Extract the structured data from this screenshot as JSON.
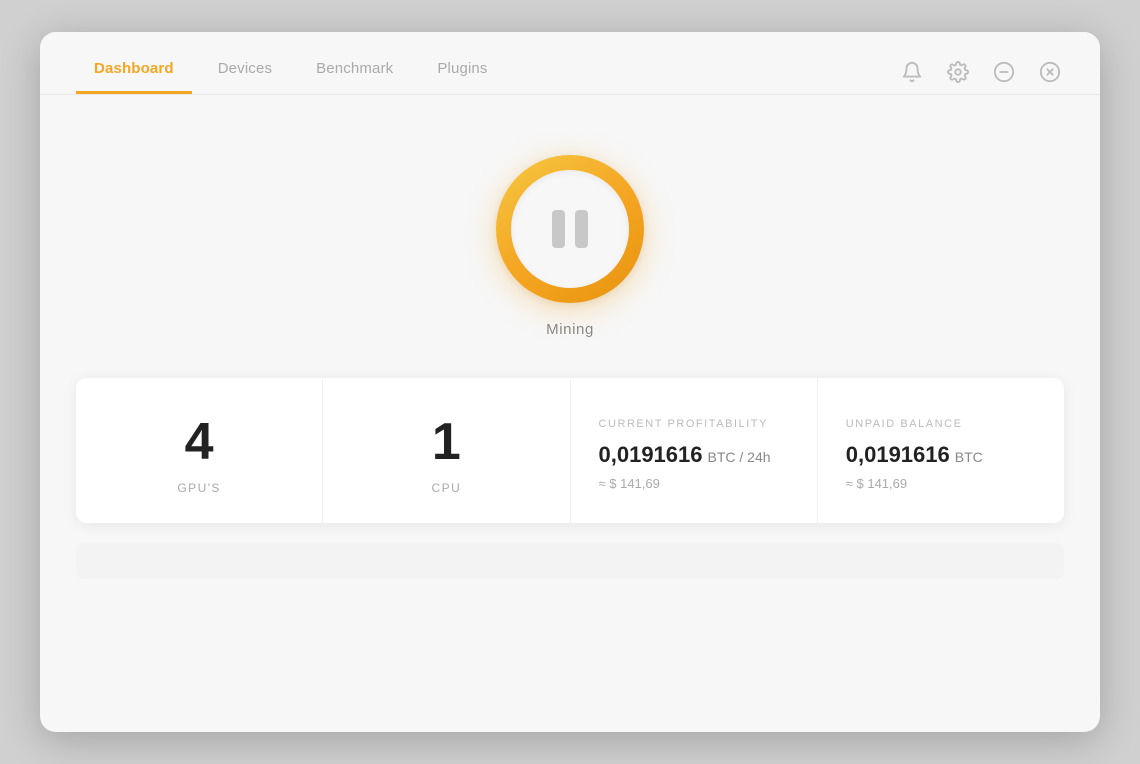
{
  "nav": {
    "tabs": [
      {
        "id": "dashboard",
        "label": "Dashboard",
        "active": true
      },
      {
        "id": "devices",
        "label": "Devices",
        "active": false
      },
      {
        "id": "benchmark",
        "label": "Benchmark",
        "active": false
      },
      {
        "id": "plugins",
        "label": "Plugins",
        "active": false
      }
    ]
  },
  "header_icons": {
    "bell": "🔔",
    "settings": "⚙",
    "minimize": "⊖",
    "close": "⊗"
  },
  "mining": {
    "status_label": "Mining"
  },
  "stats": {
    "gpus": {
      "value": "4",
      "label": "GPU'S"
    },
    "cpu": {
      "value": "1",
      "label": "CPU"
    },
    "profitability": {
      "section_label": "CURRENT PROFITABILITY",
      "btc_value": "0,0191616",
      "btc_unit": "BTC / 24h",
      "approx": "≈ $ 141,69"
    },
    "balance": {
      "section_label": "UNPAID BALANCE",
      "btc_value": "0,0191616",
      "btc_unit": "BTC",
      "approx": "≈ $ 141,69"
    }
  }
}
